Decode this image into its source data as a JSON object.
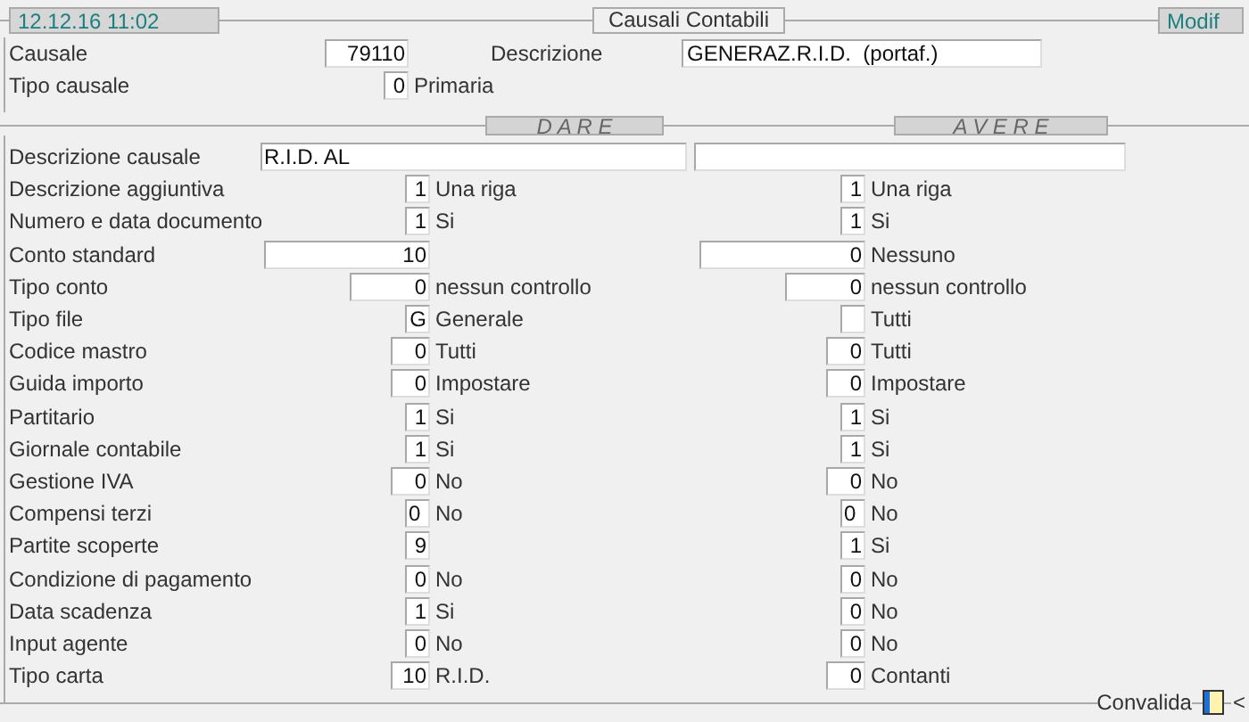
{
  "header": {
    "datetime": "12.12.16 11:02",
    "title": "Causali Contabili",
    "mode": "Modif"
  },
  "causale": {
    "label": "Causale",
    "value": "79110",
    "desc_label": "Descrizione",
    "desc_value": "GENERAZ.R.I.D.  (portaf.)"
  },
  "tipo_causale": {
    "label": "Tipo causale",
    "value": "0",
    "text": "Primaria"
  },
  "columns": [
    "D A R E",
    "A V E R E"
  ],
  "descrizione_causale": {
    "label": "Descrizione causale",
    "dare": "R.I.D. AL"
  },
  "rows": [
    {
      "label": "Descrizione aggiuntiva",
      "dare": {
        "value": "1",
        "text": "Una riga"
      },
      "avere": {
        "value": "1",
        "text": "Una riga"
      }
    },
    {
      "label": "Numero e data documento",
      "dare": {
        "value": "1",
        "text": "Si"
      },
      "avere": {
        "value": "1",
        "text": "Si"
      }
    },
    {
      "label": "Conto standard",
      "dare": {
        "value": "10"
      },
      "avere": {
        "value": "0",
        "text": "Nessuno"
      }
    },
    {
      "label": "Tipo conto",
      "dare": {
        "value": "0",
        "text": "nessun controllo"
      },
      "avere": {
        "value": "0",
        "text": "nessun controllo"
      }
    },
    {
      "label": "Tipo file",
      "dare": {
        "value": "G",
        "text": "Generale"
      },
      "avere": {
        "text": "Tutti"
      }
    },
    {
      "label": "Codice mastro",
      "dare": {
        "value": "0",
        "text": "Tutti"
      },
      "avere": {
        "value": "0",
        "text": "Tutti"
      }
    },
    {
      "label": "Guida importo",
      "dare": {
        "value": "0",
        "text": "Impostare"
      },
      "avere": {
        "value": "0",
        "text": "Impostare"
      }
    },
    {
      "label": "Partitario",
      "dare": {
        "value": "1",
        "text": "Si"
      },
      "avere": {
        "value": "1",
        "text": "Si"
      }
    },
    {
      "label": "Giornale contabile",
      "dare": {
        "value": "1",
        "text": "Si"
      },
      "avere": {
        "value": "1",
        "text": "Si"
      }
    },
    {
      "label": "Gestione IVA",
      "dare": {
        "value": "0",
        "text": "No"
      },
      "avere": {
        "value": "0",
        "text": "No"
      }
    },
    {
      "label": "Compensi terzi",
      "dare": {
        "value": "0",
        "text": "No"
      },
      "avere": {
        "value": "0",
        "text": "No"
      }
    },
    {
      "label": "Partite scoperte",
      "dare": {
        "value": "9"
      },
      "avere": {
        "value": "1",
        "text": "Si"
      }
    },
    {
      "label": "Condizione di pagamento",
      "dare": {
        "value": "0",
        "text": "No"
      },
      "avere": {
        "value": "0",
        "text": "No"
      }
    },
    {
      "label": "Data scadenza",
      "dare": {
        "value": "1",
        "text": "Si"
      },
      "avere": {
        "value": "0",
        "text": "No"
      }
    },
    {
      "label": "Input agente",
      "dare": {
        "value": "0",
        "text": "No"
      },
      "avere": {
        "value": "0",
        "text": "No"
      }
    },
    {
      "label": "Tipo carta",
      "dare": {
        "value": "10",
        "text": "R.I.D."
      },
      "avere": {
        "value": "0",
        "text": "Contanti"
      }
    }
  ],
  "footer": {
    "label": "Convalida",
    "marker": "<"
  }
}
